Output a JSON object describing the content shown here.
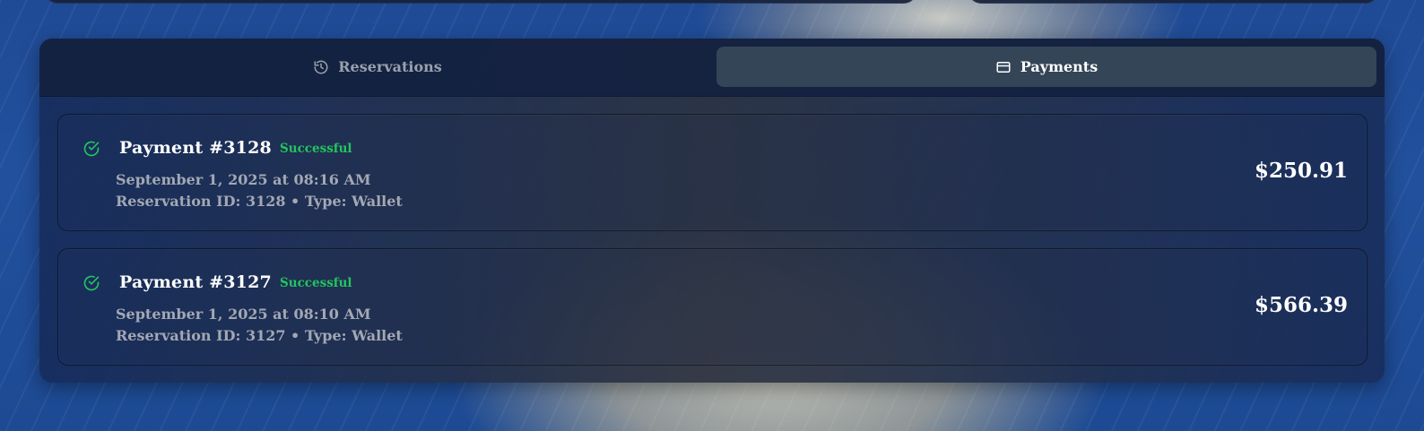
{
  "tabs": [
    {
      "label": "Reservations",
      "icon": "history-icon",
      "active": false
    },
    {
      "label": "Payments",
      "icon": "credit-card-icon",
      "active": true
    }
  ],
  "payments": [
    {
      "title": "Payment #3128",
      "status": "Successful",
      "date": "September 1, 2025 at 08:16 AM",
      "meta": "Reservation ID: 3128 • Type: Wallet",
      "amount": "$250.91",
      "icon": "check-circle-icon"
    },
    {
      "title": "Payment #3127",
      "status": "Successful",
      "date": "September 1, 2025 at 08:10 AM",
      "meta": "Reservation ID: 3127 • Type: Wallet",
      "amount": "$566.39",
      "icon": "check-circle-icon"
    }
  ],
  "colors": {
    "success": "#22c55e",
    "active_tab": "#344558",
    "panel": "#1f2d4a"
  }
}
